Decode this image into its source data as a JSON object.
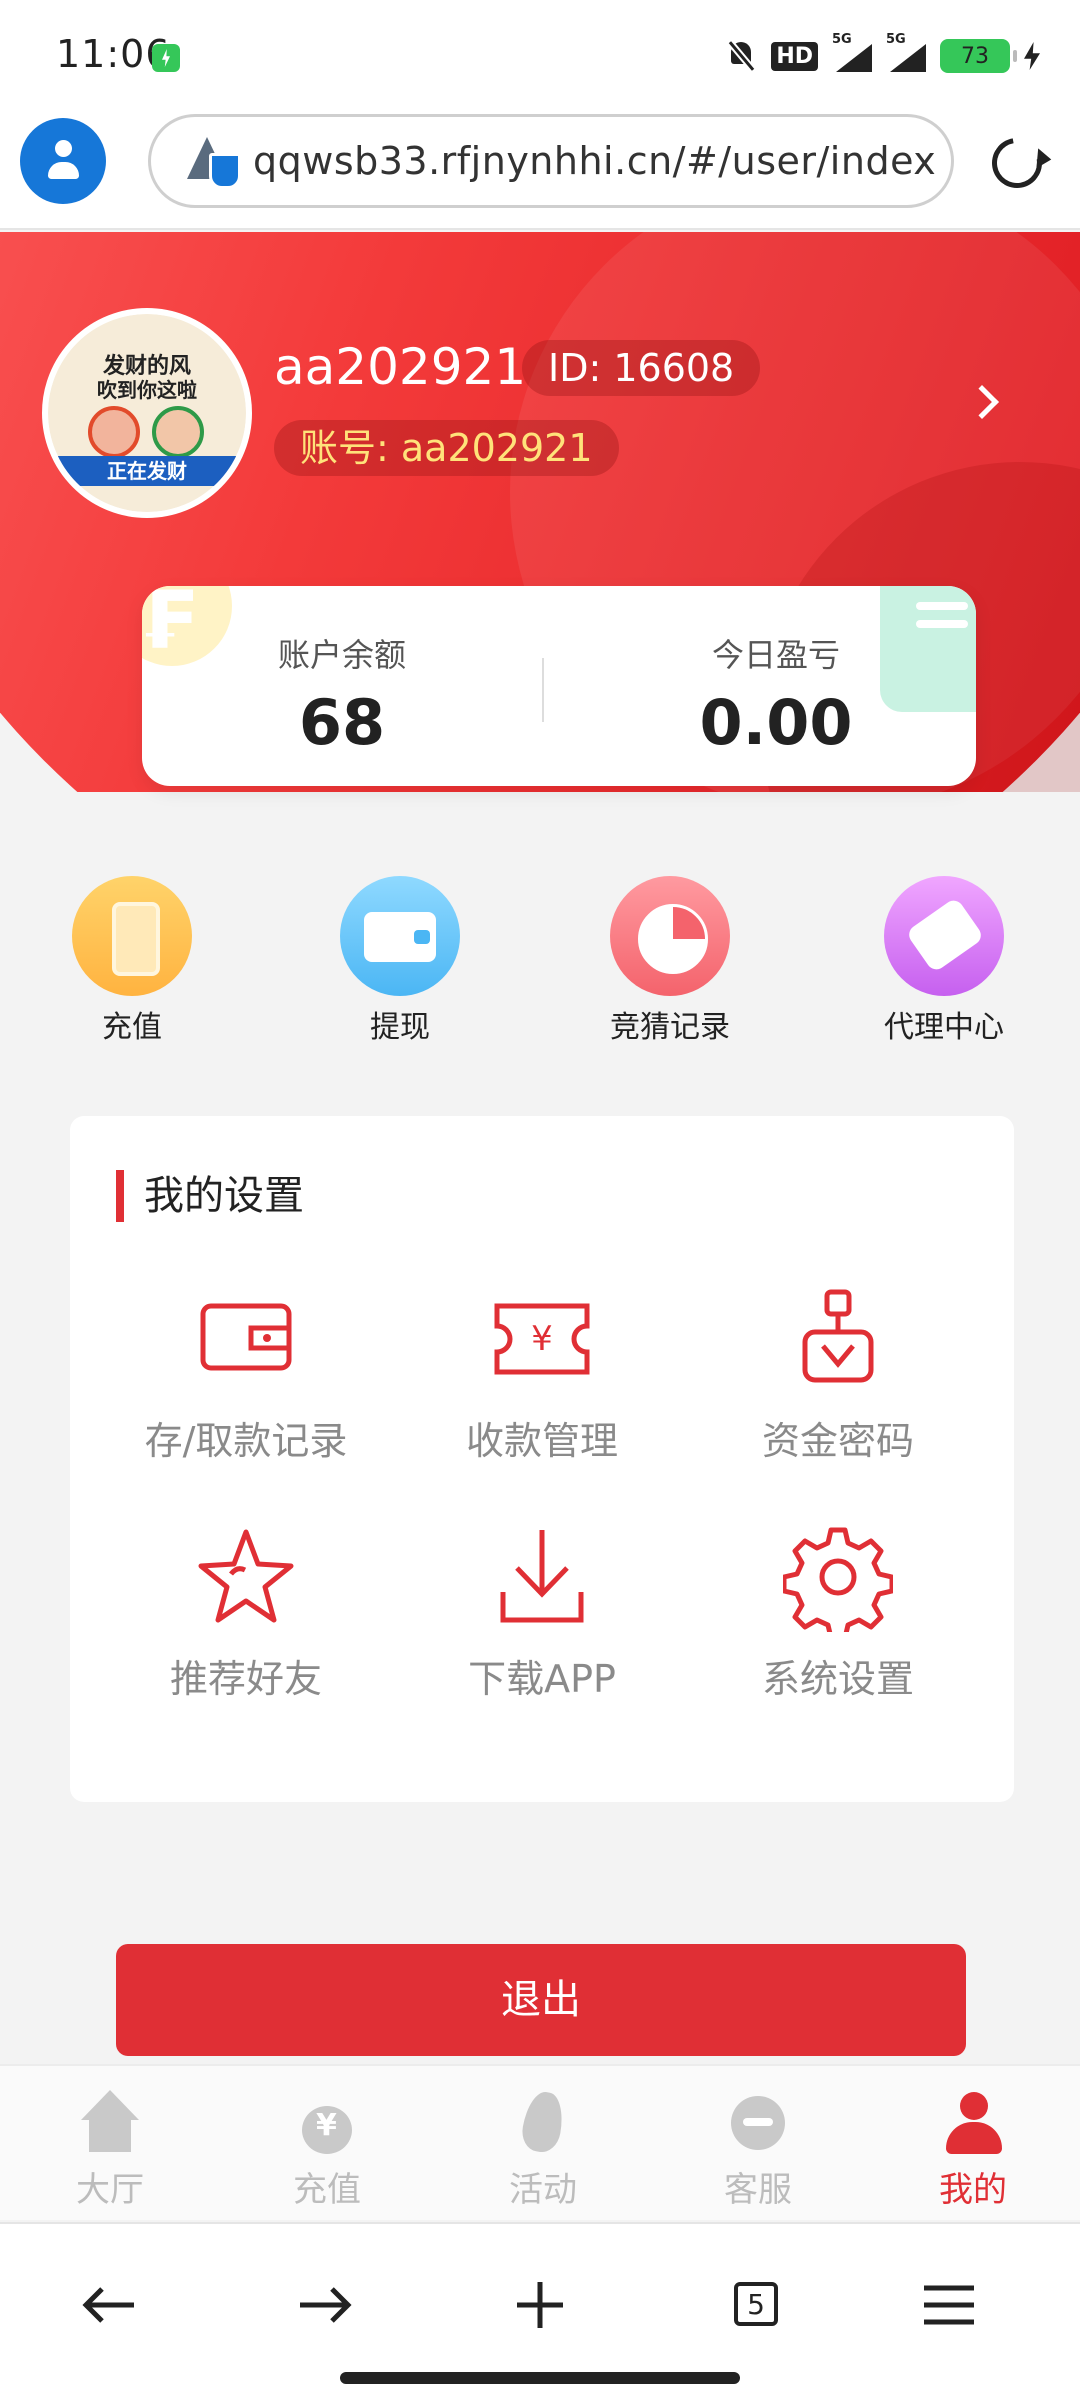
{
  "status_bar": {
    "time": "11:06",
    "hd": "HD",
    "signal1": "5G",
    "signal2": "5G",
    "battery": "73"
  },
  "browser": {
    "url": "qqwsb33.rfjnynhhi.cn/#/user/index",
    "tab_count": "5"
  },
  "user": {
    "avatar_line1": "发财的风",
    "avatar_line2": "吹到你这啦",
    "avatar_banner": "正在发财",
    "username": "aa202921",
    "id_label": "ID: 16608",
    "account_label": "账号: aa202921"
  },
  "balance": {
    "account_balance_label": "账户余额",
    "account_balance_value": "68",
    "today_pnl_label": "今日盈亏",
    "today_pnl_value": "0.00"
  },
  "quick_actions": [
    {
      "label": "充值",
      "icon": "phone-icon"
    },
    {
      "label": "提现",
      "icon": "wallet-icon"
    },
    {
      "label": "竞猜记录",
      "icon": "pie-chart-icon"
    },
    {
      "label": "代理中心",
      "icon": "handshake-icon"
    }
  ],
  "settings": {
    "title": "我的设置",
    "items": [
      {
        "label": "存/取款记录",
        "icon": "wallet-outline-icon"
      },
      {
        "label": "收款管理",
        "icon": "ticket-yen-icon"
      },
      {
        "label": "资金密码",
        "icon": "lock-password-icon"
      },
      {
        "label": "推荐好友",
        "icon": "star-icon"
      },
      {
        "label": "下载APP",
        "icon": "download-icon"
      },
      {
        "label": "系统设置",
        "icon": "gear-icon"
      }
    ]
  },
  "logout_label": "退出",
  "tabbar": [
    {
      "label": "大厅",
      "icon": "home-icon"
    },
    {
      "label": "充值",
      "icon": "moneybag-icon"
    },
    {
      "label": "活动",
      "icon": "flame-icon"
    },
    {
      "label": "客服",
      "icon": "customer-service-icon"
    },
    {
      "label": "我的",
      "icon": "person-icon",
      "active": true
    }
  ],
  "colors": {
    "brand_red": "#e02f35",
    "link_blue": "#1677d8"
  }
}
